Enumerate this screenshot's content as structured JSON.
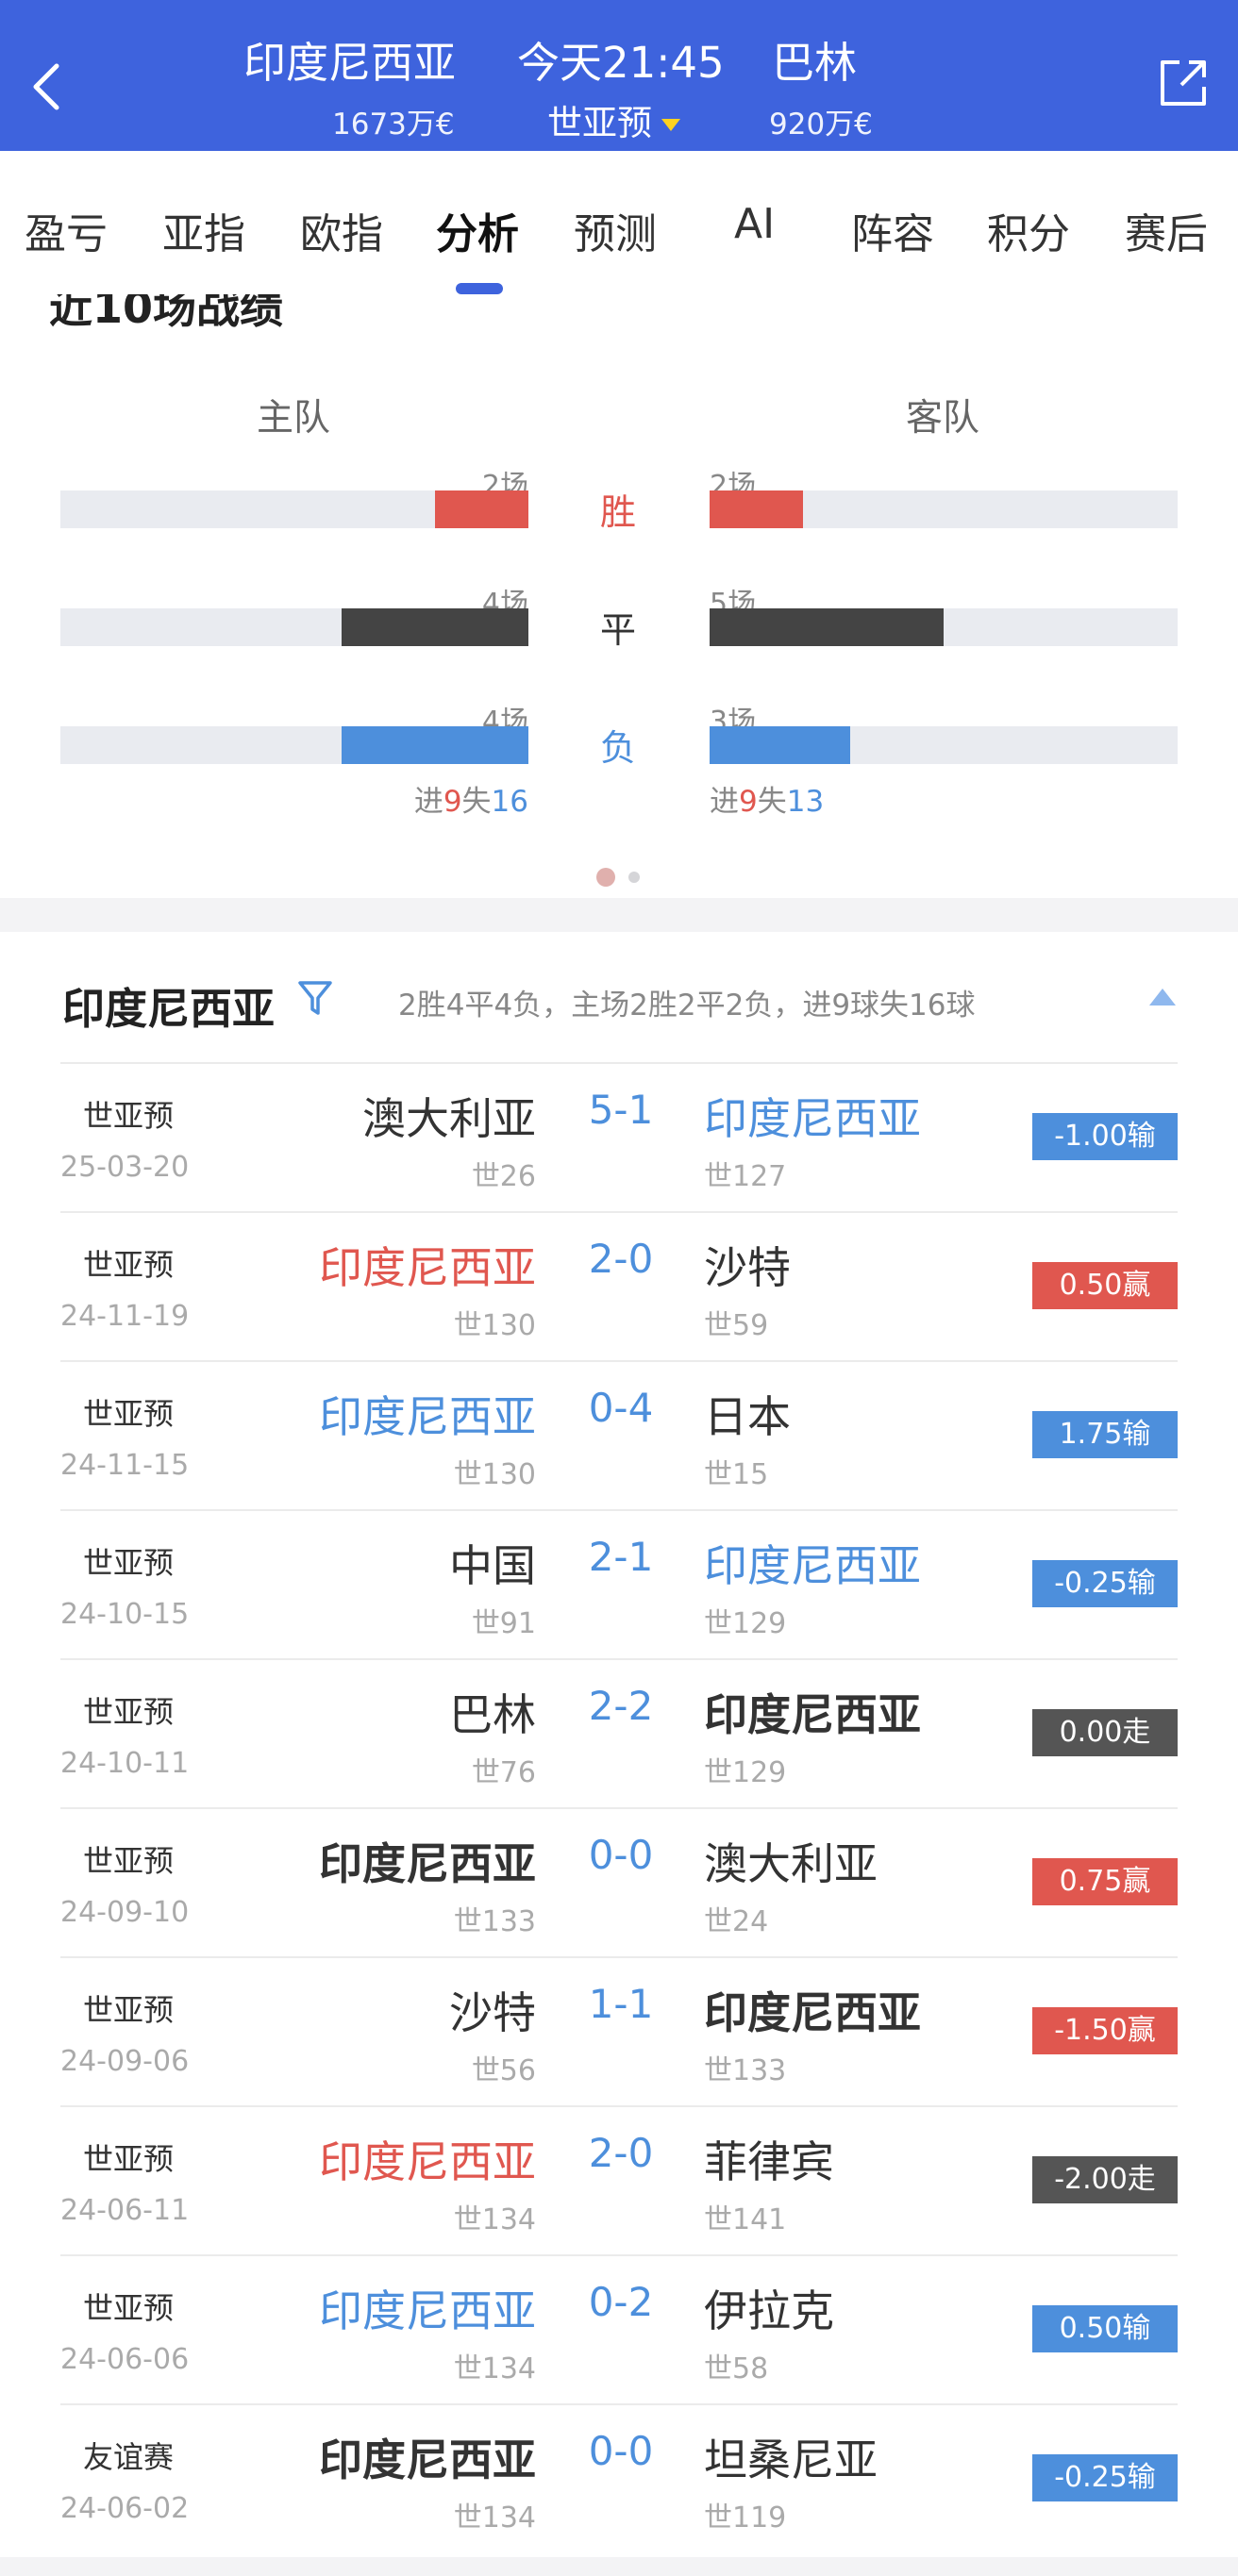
{
  "header": {
    "home_team": "印度尼西亚",
    "time": "今天21:45",
    "away_team": "巴林",
    "home_value": "1673万€",
    "competition": "世亚预",
    "away_value": "920万€"
  },
  "tabs": [
    "盈亏",
    "亚指",
    "欧指",
    "分析",
    "预测",
    "AI",
    "阵容",
    "积分",
    "赛后"
  ],
  "active_tab": "分析",
  "recent": {
    "title": "近10场战绩",
    "home_label": "主队",
    "away_label": "客队",
    "rows": [
      {
        "label": "胜",
        "home": "2场",
        "away": "2场",
        "home_frac": 0.2,
        "away_frac": 0.2,
        "color": "#e0574f"
      },
      {
        "label": "平",
        "home": "4场",
        "away": "5场",
        "home_frac": 0.4,
        "away_frac": 0.5,
        "color": "#444444"
      },
      {
        "label": "负",
        "home": "4场",
        "away": "3场",
        "home_frac": 0.4,
        "away_frac": 0.3,
        "color": "#4d8fdc"
      }
    ],
    "home_goals": {
      "pre": "进",
      "for": "9",
      "mid": "失",
      "against": "16"
    },
    "away_goals": {
      "pre": "进",
      "for": "9",
      "mid": "失",
      "against": "13"
    }
  },
  "history": {
    "team": "印度尼西亚",
    "summary": "2胜4平4负，主场2胜2平2负，进9球失16球",
    "matches": [
      {
        "comp": "世亚预",
        "date": "25-03-20",
        "home": "澳大利亚",
        "home_rank": "世26",
        "score": "5-1",
        "away": "印度尼西亚",
        "away_rank": "世127",
        "result": "-1.00输",
        "home_style": "",
        "away_style": "blue",
        "res": "b"
      },
      {
        "comp": "世亚预",
        "date": "24-11-19",
        "home": "印度尼西亚",
        "home_rank": "世130",
        "score": "2-0",
        "away": "沙特",
        "away_rank": "世59",
        "result": "0.50赢",
        "home_style": "red",
        "away_style": "",
        "res": "r"
      },
      {
        "comp": "世亚预",
        "date": "24-11-15",
        "home": "印度尼西亚",
        "home_rank": "世130",
        "score": "0-4",
        "away": "日本",
        "away_rank": "世15",
        "result": "1.75输",
        "home_style": "blue",
        "away_style": "",
        "res": "b"
      },
      {
        "comp": "世亚预",
        "date": "24-10-15",
        "home": "中国",
        "home_rank": "世91",
        "score": "2-1",
        "away": "印度尼西亚",
        "away_rank": "世129",
        "result": "-0.25输",
        "home_style": "",
        "away_style": "blue",
        "res": "b"
      },
      {
        "comp": "世亚预",
        "date": "24-10-11",
        "home": "巴林",
        "home_rank": "世76",
        "score": "2-2",
        "away": "印度尼西亚",
        "away_rank": "世129",
        "result": "0.00走",
        "home_style": "",
        "away_style": "dark",
        "res": "g"
      },
      {
        "comp": "世亚预",
        "date": "24-09-10",
        "home": "印度尼西亚",
        "home_rank": "世133",
        "score": "0-0",
        "away": "澳大利亚",
        "away_rank": "世24",
        "result": "0.75赢",
        "home_style": "dark",
        "away_style": "",
        "res": "r"
      },
      {
        "comp": "世亚预",
        "date": "24-09-06",
        "home": "沙特",
        "home_rank": "世56",
        "score": "1-1",
        "away": "印度尼西亚",
        "away_rank": "世133",
        "result": "-1.50赢",
        "home_style": "",
        "away_style": "dark",
        "res": "r"
      },
      {
        "comp": "世亚预",
        "date": "24-06-11",
        "home": "印度尼西亚",
        "home_rank": "世134",
        "score": "2-0",
        "away": "菲律宾",
        "away_rank": "世141",
        "result": "-2.00走",
        "home_style": "red",
        "away_style": "",
        "res": "g"
      },
      {
        "comp": "世亚预",
        "date": "24-06-06",
        "home": "印度尼西亚",
        "home_rank": "世134",
        "score": "0-2",
        "away": "伊拉克",
        "away_rank": "世58",
        "result": "0.50输",
        "home_style": "blue",
        "away_style": "",
        "res": "b"
      },
      {
        "comp": "友谊赛",
        "date": "24-06-02",
        "home": "印度尼西亚",
        "home_rank": "世134",
        "score": "0-0",
        "away": "坦桑尼亚",
        "away_rank": "世119",
        "result": "-0.25输",
        "home_style": "dark",
        "away_style": "",
        "res": "b"
      }
    ]
  }
}
